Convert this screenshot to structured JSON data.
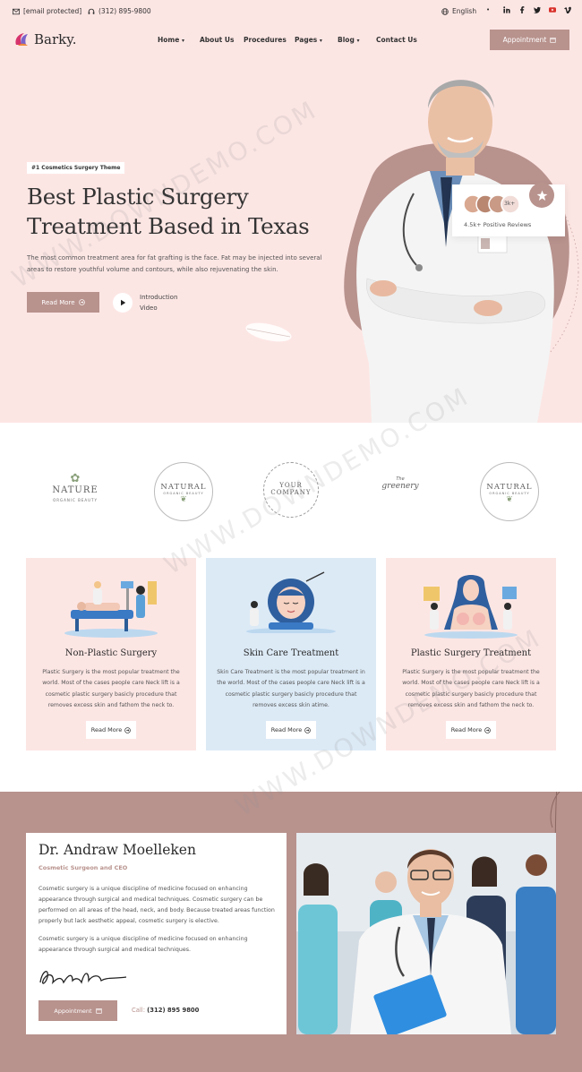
{
  "topbar": {
    "email": "[email protected]",
    "phone": "(312) 895-9800",
    "language": "English",
    "socials": [
      "linkedin-icon",
      "facebook-icon",
      "twitter-icon",
      "youtube-icon",
      "vimeo-icon"
    ]
  },
  "brand": {
    "name": "Barky."
  },
  "nav": {
    "items": [
      {
        "label": "Home",
        "dropdown": true
      },
      {
        "label": "About Us",
        "dropdown": false
      },
      {
        "label": "Procedures",
        "dropdown": false
      },
      {
        "label": "Pages",
        "dropdown": true
      },
      {
        "label": "Blog",
        "dropdown": true
      },
      {
        "label": "Contact Us",
        "dropdown": false
      }
    ],
    "cta": "Appointment"
  },
  "hero": {
    "badge": "#1 Cosmetics Surgery Theme",
    "title_line1": "Best Plastic Surgery",
    "title_line2": "Treatment Based in Texas",
    "lead": "The most common treatment area for fat grafting is the face. Fat may be injected into several areas to restore youthful volume and contours, while also rejuvenating the skin.",
    "read_more": "Read More",
    "video_line1": "Introduction",
    "video_line2": "Video",
    "reviews_count_badge": "3k+",
    "reviews_text": "4.5k+ Positive Reviews"
  },
  "brands": [
    {
      "top": "NATURE",
      "sub": "ORGANIC BEAUTY"
    },
    {
      "top": "NATURAL",
      "sub": "ORGANIC BEAUTY"
    },
    {
      "top": "YOUR",
      "sub": "COMPANY"
    },
    {
      "top": "greenery",
      "sub": "The"
    },
    {
      "top": "NATURAL",
      "sub": "ORGANIC BEAUTY"
    }
  ],
  "services": [
    {
      "title": "Non-Plastic Surgery",
      "desc": "Plastic Surgery is the most popular treatment the world. Most of the cases people care Neck lift is a cosmetic plastic surgery basicly procedure that removes excess skin and fathom the neck to.",
      "button": "Read More",
      "bg": "#fce6e4"
    },
    {
      "title": "Skin Care Treatment",
      "desc": "Skin Care Treatment is the most popular treatment in the world. Most of the cases people care Neck lift is a cosmetic plastic surgery basicly procedure that removes excess skin atime.",
      "button": "Read More",
      "bg": "#dceaf6"
    },
    {
      "title": "Plastic Surgery Treatment",
      "desc": "Plastic Surgery is the most popular treatment the world. Most of the cases people care Neck lift is a cosmetic plastic surgery basicly procedure that removes excess skin and fathom the neck to.",
      "button": "Read More",
      "bg": "#fce6e4"
    }
  ],
  "about": {
    "name": "Dr. Andraw Moelleken",
    "role": "Cosmetic Surgeon and CEO",
    "p1": "Cosmetic surgery is a unique discipline of medicine focused on enhancing appearance through surgical and medical techniques. Cosmetic surgery can be performed on all areas of the head, neck, and body. Because treated areas function properly but lack aesthetic appeal, cosmetic surgery is elective.",
    "p2": "Cosmetic surgery is a unique discipline of medicine focused on enhancing appearance through surgical and medical techniques.",
    "button": "Appointment",
    "call_label": "Call:",
    "call_number": "(312) 895 9800"
  },
  "watermark": "WWW.DOWNDEMO.COM",
  "colors": {
    "accent": "#b8928d",
    "hero_bg": "#fce6e4",
    "blue_card": "#dceaf6"
  }
}
